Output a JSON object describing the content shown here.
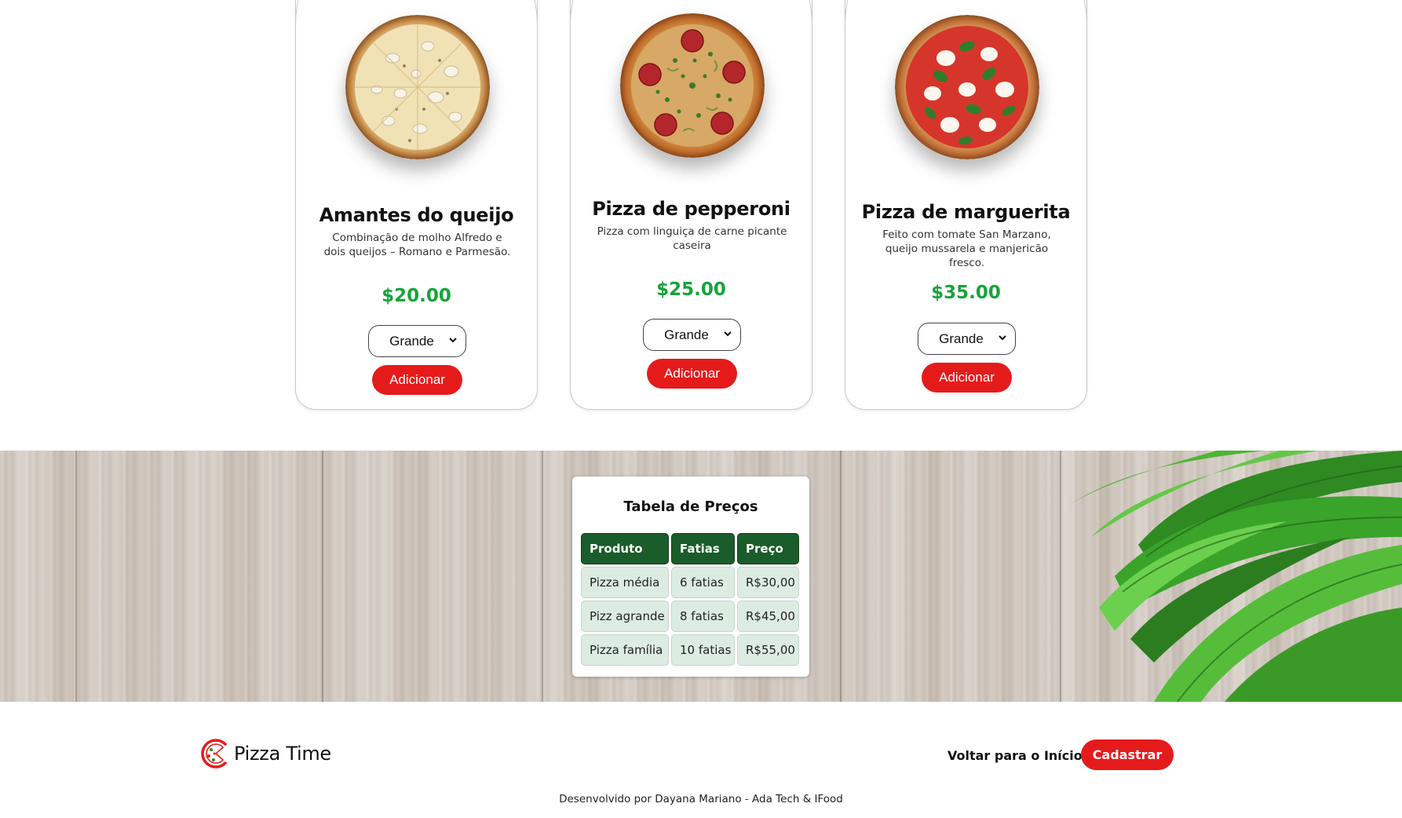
{
  "menu": {
    "cards": [
      {
        "title": "Amantes do queijo",
        "description": "Combinação de molho Alfredo e dois queijos – Romano e Parmesão.",
        "price": "$20.00",
        "size": "Grande",
        "button": "Adicionar",
        "image": "cheese-pizza-photo"
      },
      {
        "title": "Pizza de pepperoni",
        "description": "Pizza com linguiça de carne picante caseira",
        "price": "$25.00",
        "size": "Grande",
        "button": "Adicionar",
        "image": "pepperoni-pizza-photo"
      },
      {
        "title": "Pizza de marguerita",
        "description": "Feito com tomate San Marzano, queijo mussarela e manjericão fresco.",
        "price": "$35.00",
        "size": "Grande",
        "button": "Adicionar",
        "image": "margherita-pizza-photo"
      }
    ]
  },
  "price_table": {
    "title": "Tabela de Preços",
    "headers": [
      "Produto",
      "Fatias",
      "Preço"
    ],
    "rows": [
      [
        "Pizza média",
        "6 fatias",
        "R$30,00"
      ],
      [
        "Pizz agrande",
        "8 fatias",
        "R$45,00"
      ],
      [
        "Pizza família",
        "10 fatias",
        "R$55,00"
      ]
    ]
  },
  "footer": {
    "brand": "Pizza Time",
    "nav_link": "Voltar para o Início",
    "cta": "Cadastrar",
    "credits": "Desenvolvido por Dayana Mariano - Ada Tech & IFood"
  },
  "colors": {
    "accent_red": "#e51b1b",
    "price_green": "#17a33a",
    "table_header_green": "#1a5c2a",
    "table_cell_green": "#ddece1"
  }
}
